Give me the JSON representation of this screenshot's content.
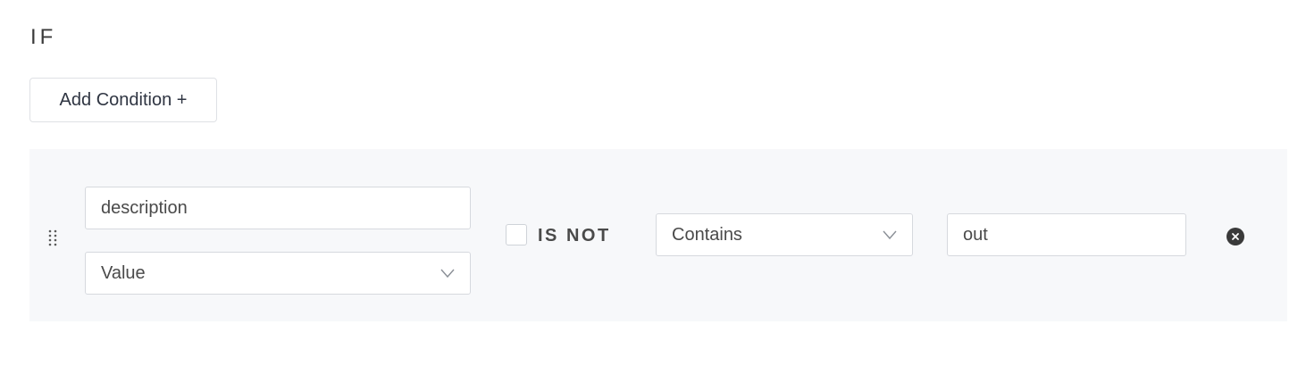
{
  "section": {
    "title": "IF"
  },
  "toolbar": {
    "add_condition_label": "Add Condition +"
  },
  "condition": {
    "field_name": "description",
    "field_type": "Value",
    "negate_checked": false,
    "negate_label": "IS NOT",
    "operator": "Contains",
    "value": "out"
  },
  "icons": {
    "drag": "drag-handle-icon",
    "chevron": "chevron-down-icon",
    "remove": "close-circle-icon"
  }
}
